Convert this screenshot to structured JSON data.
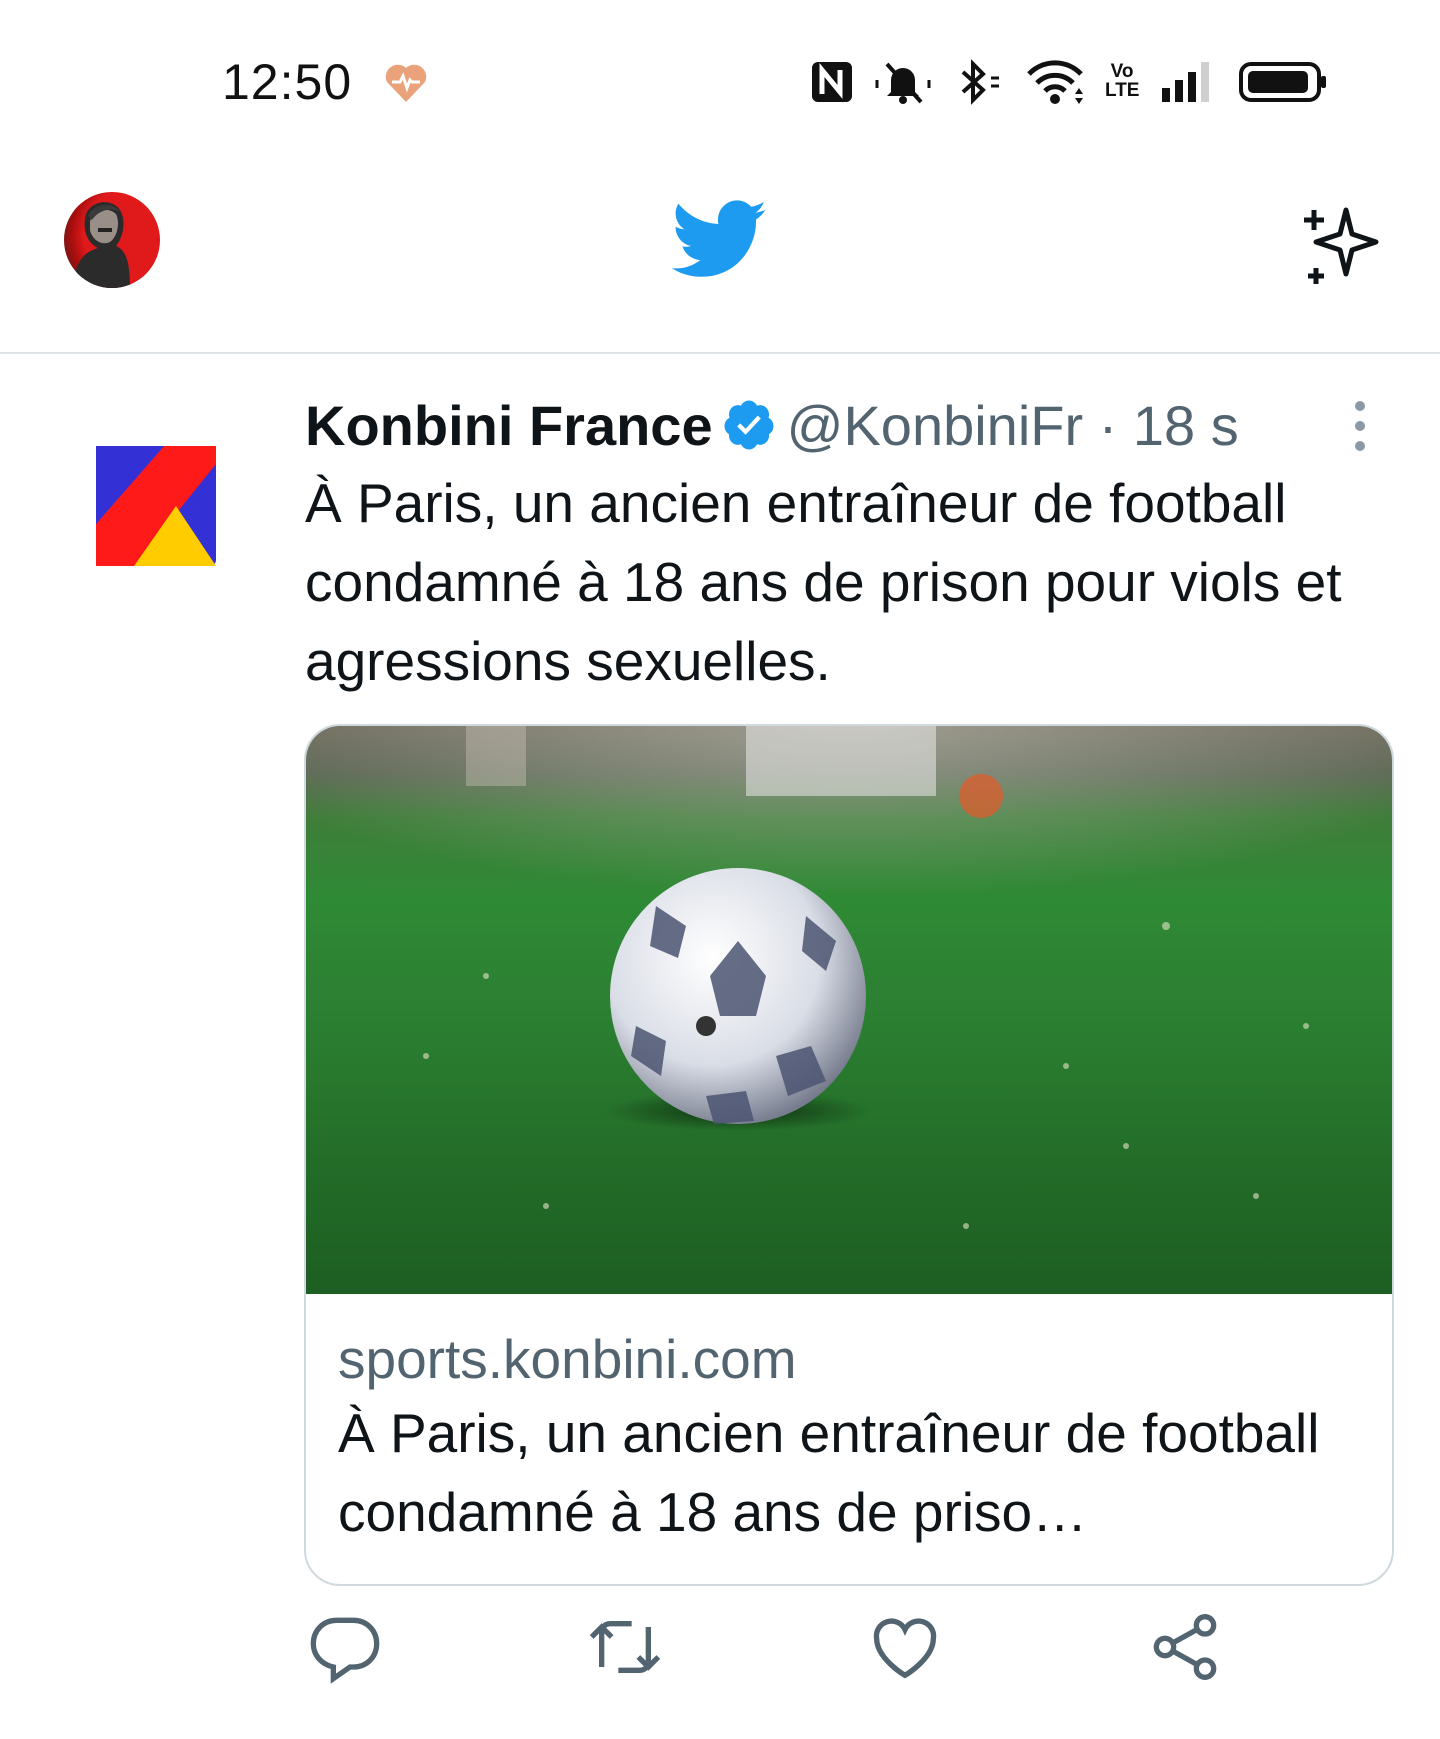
{
  "status_bar": {
    "time": "12:50",
    "icons": [
      "health-icon",
      "nfc-icon",
      "mute-icon",
      "bluetooth-icon",
      "wifi-icon",
      "volte-icon",
      "signal-icon",
      "battery-icon"
    ],
    "volte_top": "Vo",
    "volte_bottom": "LTE"
  },
  "header": {
    "left_icon": "profile-avatar",
    "center_icon": "twitter-bird-icon",
    "right_icon": "sparkle-icon",
    "brand_color": "#1d9bf0"
  },
  "tweet": {
    "author_name": "Konbini France",
    "verified": true,
    "handle": "@KonbiniFr",
    "separator": "·",
    "time": "18 s",
    "text": "À Paris, un ancien entraîneur de football condamné à 18 ans de prison pour viols et agressions sexuelles.",
    "card": {
      "domain": "sports.konbini.com",
      "title": "À Paris, un ancien entraîneur de football condamné à 18 ans de priso…"
    },
    "actions": [
      "reply-icon",
      "retweet-icon",
      "like-icon",
      "share-icon"
    ]
  },
  "colors": {
    "verified_blue": "#1d9bf0",
    "secondary_text": "#536471",
    "konbini_blue": "#3330d6",
    "konbini_red": "#ff1a1a",
    "konbini_yellow": "#ffcc00"
  }
}
